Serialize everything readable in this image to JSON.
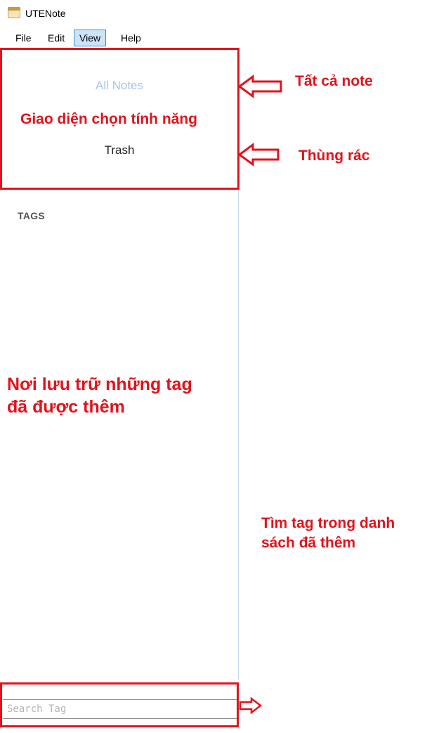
{
  "window": {
    "title": "UTENote",
    "icon": "notepad-icon"
  },
  "menu": {
    "items": [
      {
        "label": "File"
      },
      {
        "label": "Edit"
      },
      {
        "label": "View",
        "active": true
      },
      {
        "label": "Help"
      }
    ]
  },
  "nav": {
    "all_notes": "All Notes",
    "trash": "Trash"
  },
  "tags": {
    "header": "TAGS"
  },
  "search": {
    "placeholder": "Search Tag",
    "value": ""
  },
  "annotations": {
    "feature_panel": "Giao diện chọn tính năng",
    "all_notes_label": "Tất cả note",
    "trash_label": "Thùng rác",
    "tag_store_line1": "Nơi lưu trữ những tag",
    "tag_store_line2": "đã được thêm",
    "search_line1": "Tìm tag trong danh",
    "search_line2": "sách đã thêm"
  },
  "colors": {
    "annotation_red": "#e3121b",
    "all_notes_text": "#a9c4ea",
    "menu_active_bg": "#cce4f7"
  }
}
